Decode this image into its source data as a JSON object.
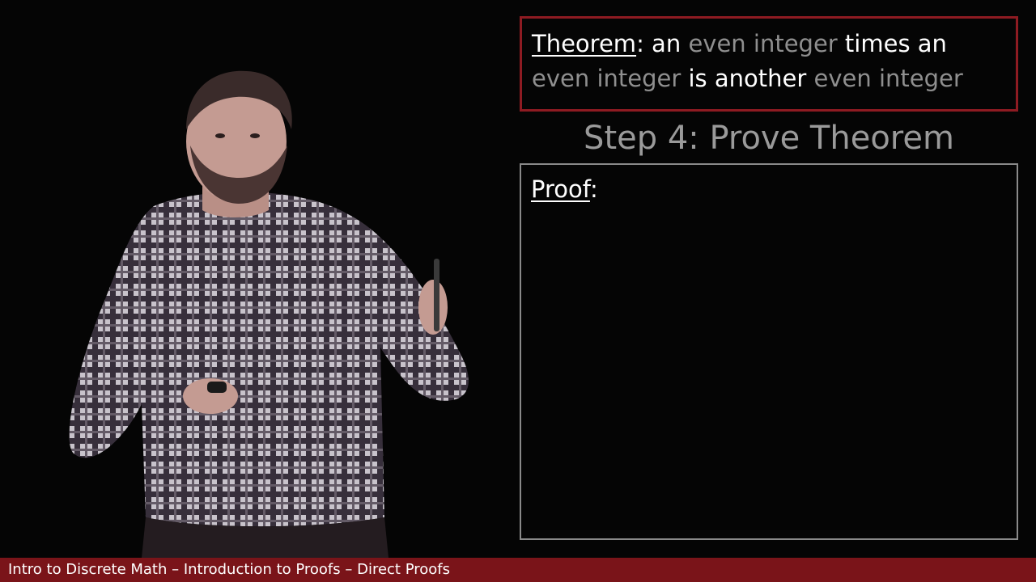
{
  "theorem": {
    "heading": "Theorem",
    "colon": ":",
    "seg1": " an ",
    "seg2": "even integer",
    "seg3": " times an ",
    "seg4": "even integer",
    "seg5": " is another ",
    "seg6": "even integer"
  },
  "step_title": "Step 4: Prove Theorem",
  "proof": {
    "heading": "Proof",
    "colon": ":"
  },
  "footer": {
    "course_title": "Intro to Discrete Math – Introduction to Proofs – Direct Proofs"
  },
  "colors": {
    "accent_red": "#8e1b22",
    "footer_red": "#7a1419",
    "muted_text": "#8f8f8f",
    "step_title": "#9a9a9a",
    "proof_border": "#8a8a8a"
  }
}
